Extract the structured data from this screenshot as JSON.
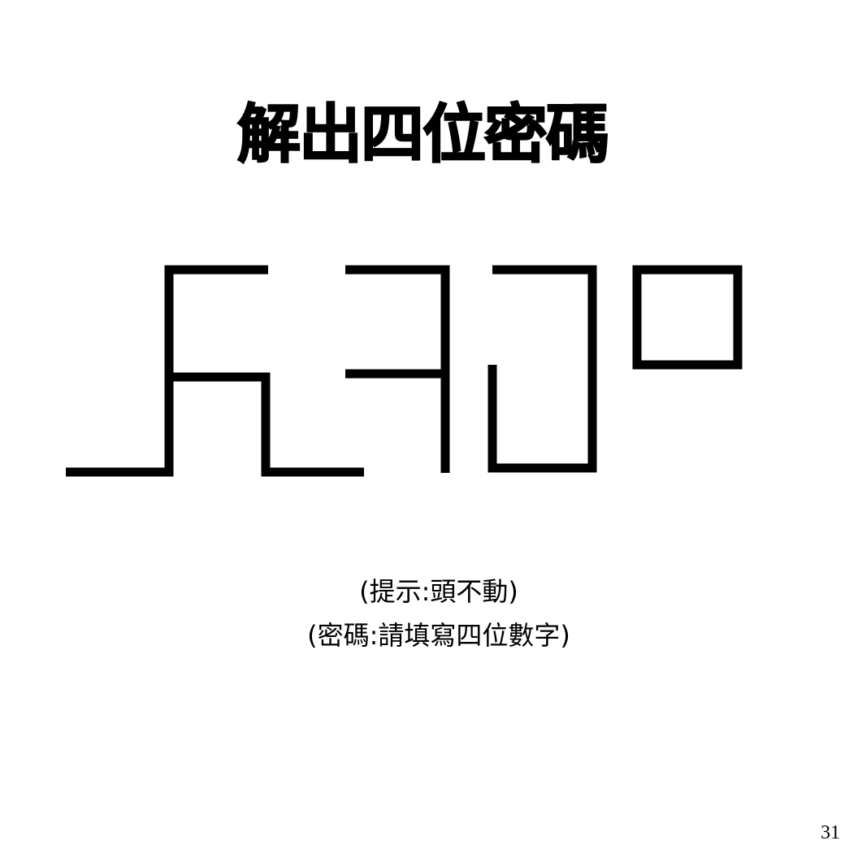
{
  "title": "解出四位密碼",
  "hints": {
    "line1": "(提示:頭不動)",
    "line2": "(密碼:請填寫四位數字)"
  },
  "page_number": "31",
  "colors": {
    "background": "#ffffff",
    "ink": "#000000"
  }
}
